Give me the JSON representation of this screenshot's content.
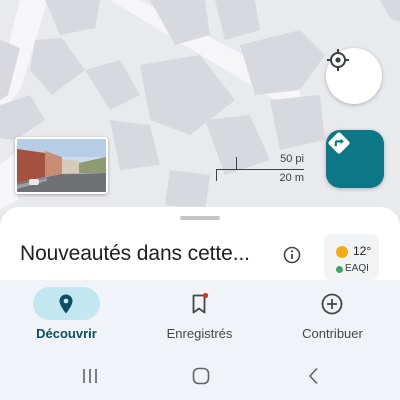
{
  "map": {
    "scale_top": "50 pi",
    "scale_bottom": "20 m"
  },
  "sheet": {
    "title": "Nouveautés dans cette...",
    "weather": {
      "temperature": "12°",
      "aqi_label": "EAQI"
    }
  },
  "bottom_nav": {
    "items": [
      {
        "label": "Découvrir",
        "icon": "location-pin-icon",
        "active": true
      },
      {
        "label": "Enregistrés",
        "icon": "bookmark-icon",
        "active": false
      },
      {
        "label": "Contribuer",
        "icon": "add-circle-icon",
        "active": false
      }
    ]
  },
  "system_nav": {
    "items": [
      "recents-icon",
      "home-icon",
      "back-icon"
    ]
  },
  "colors": {
    "accent": "#0c7786",
    "active_pill": "#c3e7f1",
    "nav_background": "#f0f4f8",
    "map_background": "#e9eaee"
  }
}
